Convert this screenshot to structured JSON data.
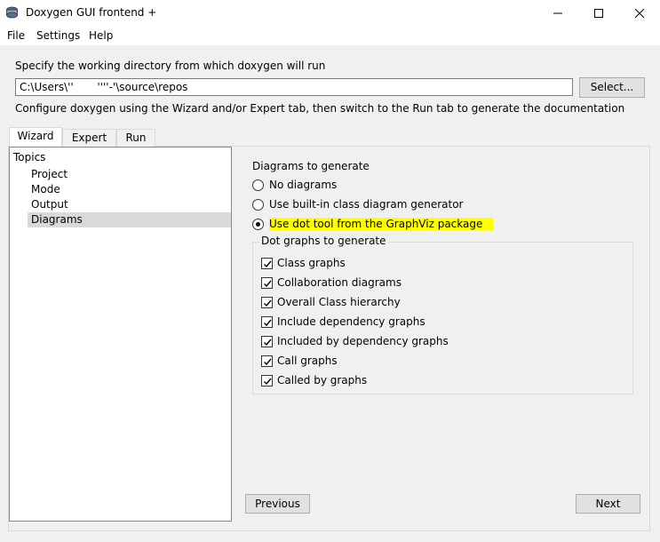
{
  "window": {
    "title": "Doxygen GUI frontend +",
    "icon": "doxygen-app-icon"
  },
  "menu": {
    "file": "File",
    "settings": "Settings",
    "help": "Help"
  },
  "workdir": {
    "label": "Specify the working directory from which doxygen will run",
    "value": "C:\\Users\\''       ''''-'\\source\\repos",
    "select_label": "Select..."
  },
  "configure_hint": "Configure doxygen using the Wizard and/or Expert tab, then switch to the Run tab to generate the documentation",
  "tabs": [
    {
      "label": "Wizard",
      "selected": true
    },
    {
      "label": "Expert",
      "selected": false
    },
    {
      "label": "Run",
      "selected": false
    }
  ],
  "topics": {
    "root": "Topics",
    "items": [
      {
        "label": "Project",
        "selected": false
      },
      {
        "label": "Mode",
        "selected": false
      },
      {
        "label": "Output",
        "selected": false
      },
      {
        "label": "Diagrams",
        "selected": true
      }
    ]
  },
  "diagrams": {
    "title": "Diagrams to generate",
    "options": [
      {
        "label": "No diagrams",
        "checked": false
      },
      {
        "label": "Use built-in class diagram generator",
        "checked": false
      },
      {
        "label": "Use dot tool from the GraphViz package",
        "checked": true
      }
    ],
    "highlight_color": "#ffff00"
  },
  "dot_graphs": {
    "title": "Dot graphs to generate",
    "items": [
      {
        "label": "Class graphs",
        "checked": true
      },
      {
        "label": "Collaboration diagrams",
        "checked": true
      },
      {
        "label": "Overall Class hierarchy",
        "checked": true
      },
      {
        "label": "Include dependency graphs",
        "checked": true
      },
      {
        "label": "Included by dependency graphs",
        "checked": true
      },
      {
        "label": "Call graphs",
        "checked": true
      },
      {
        "label": "Called by graphs",
        "checked": true
      }
    ]
  },
  "navigation": {
    "previous": "Previous",
    "next": "Next"
  }
}
